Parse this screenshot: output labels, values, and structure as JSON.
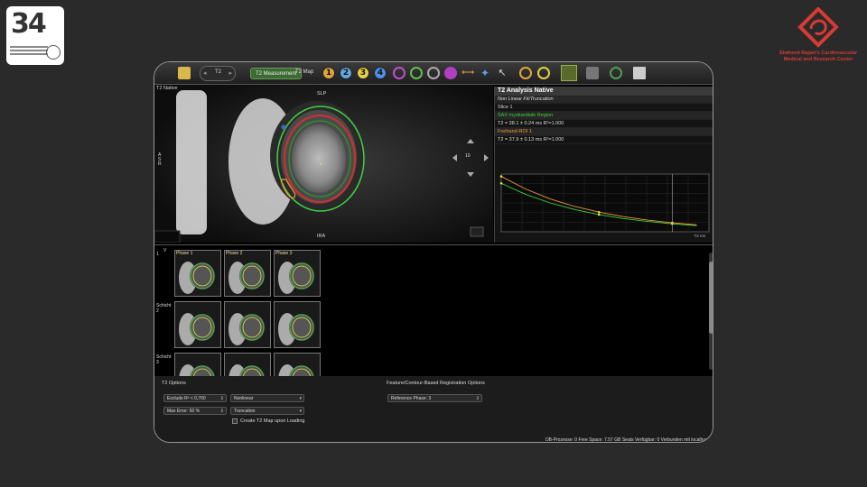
{
  "logo_left": {
    "numeral": "34"
  },
  "logo_right": {
    "name_line1": "Shaheed Rajaei's Cardiovascular",
    "name_line2": "Medical and Research Center",
    "color": "#d63b34"
  },
  "toolbar": {
    "t2_dial_label": "T2",
    "t2_measurement_label": "T2 Measurement",
    "t2_map_label": "T2 Map",
    "numbered_tools": [
      "1",
      "2",
      "3",
      "4"
    ],
    "numbered_colors": [
      "#e0a440",
      "#60a8e0",
      "#e6d040",
      "#4f8fe6"
    ]
  },
  "viewer": {
    "title": "T2 Native",
    "orientation_top": "SLP",
    "orientation_bottom": "IRA",
    "orientation_left": "ASR",
    "zoom_value": "10"
  },
  "analysis": {
    "title": "T2 Analysis Native",
    "fit_mode": "Non Linear Fit/Truncation",
    "slice": "Slice 1",
    "region1_name": "SAX myokardiale Region",
    "region1_value": "T2 = 38.1 ± 0.24 ms R²=1.000",
    "region2_name": "Freihand-ROI 1",
    "region2_value": "T2 = 37.9 ± 0.13 ms R²=1.000",
    "green": "#3fd13f",
    "orange": "#ee9a3a"
  },
  "chart_data": {
    "type": "line",
    "series": [
      {
        "name": "SAX myokardiale Region",
        "color": "#3fd13f",
        "x": [
          0,
          10,
          20,
          30,
          40,
          50,
          60,
          70,
          80
        ],
        "y": [
          420,
          324,
          250,
          193,
          149,
          115,
          89,
          69,
          53
        ]
      },
      {
        "name": "Freihand-ROI 1",
        "color": "#ee9a3a",
        "x": [
          0,
          10,
          20,
          30,
          40,
          50,
          60,
          70,
          80
        ],
        "y": [
          480,
          370,
          285,
          220,
          170,
          131,
          101,
          78,
          60
        ]
      }
    ],
    "points_x": [
      0,
      45,
      70
    ],
    "xlim": [
      0,
      85
    ],
    "ylim": [
      0,
      500
    ],
    "xlabel": "T2 ms",
    "grid": true
  },
  "thumbnails": {
    "column_header": "V",
    "rows": [
      {
        "label_line1": "",
        "label_line2": "1",
        "cells": [
          "Phase 1",
          "Phase 2",
          "Phase 3"
        ]
      },
      {
        "label_line1": "Schicht",
        "label_line2": "2",
        "cells": [
          "",
          "",
          ""
        ]
      },
      {
        "label_line1": "Schicht",
        "label_line2": "3",
        "cells": [
          "",
          "",
          ""
        ]
      }
    ]
  },
  "options": {
    "t2_options_title": "T2 Options",
    "exclude_label": "Exclude R² < 0,700",
    "max_error_label": "Max Error: 50 %",
    "fit_select": "Nonlinear",
    "truncation_select": "Truncation",
    "create_map_label": "Create T2 Map upon Loading",
    "registration_title": "Feature/Contour-Based Registration Options",
    "reference_phase": "Reference Phase: 3"
  },
  "status_bar": "DB-Prozesse: 0  Free Space: 7.57 GB  Seats Verfügbar: 0  Verbunden mit localhost"
}
